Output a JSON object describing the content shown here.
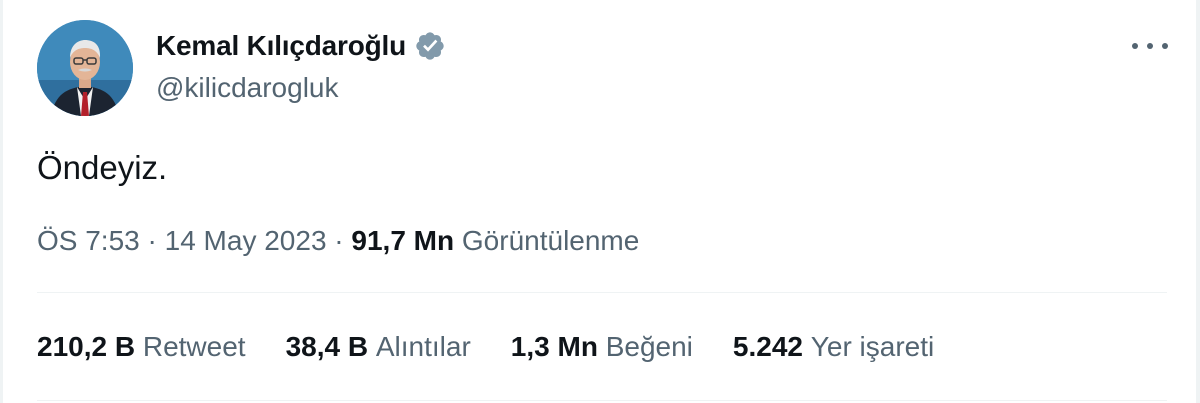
{
  "author": {
    "display_name": "Kemal Kılıçdaroğlu",
    "handle": "@kilicdarogluk",
    "verified_color": "#829aab"
  },
  "tweet": {
    "text": "Öndeyiz."
  },
  "meta": {
    "time": "ÖS 7:53",
    "sep1": " · ",
    "date": "14 May 2023",
    "sep2": " · ",
    "views_count": "91,7 Mn",
    "views_label": "Görüntülenme"
  },
  "stats": [
    {
      "count": "210,2 B",
      "label": "Retweet"
    },
    {
      "count": "38,4 B",
      "label": "Alıntılar"
    },
    {
      "count": "1,3 Mn",
      "label": "Beğeni"
    },
    {
      "count": "5.242",
      "label": "Yer işareti"
    }
  ],
  "icons": {
    "more": "more-horizontal-icon",
    "verified": "verified-badge-icon"
  },
  "colors": {
    "primary_text": "#0f1419",
    "secondary_text": "#536471",
    "divider": "#eff3f4"
  }
}
